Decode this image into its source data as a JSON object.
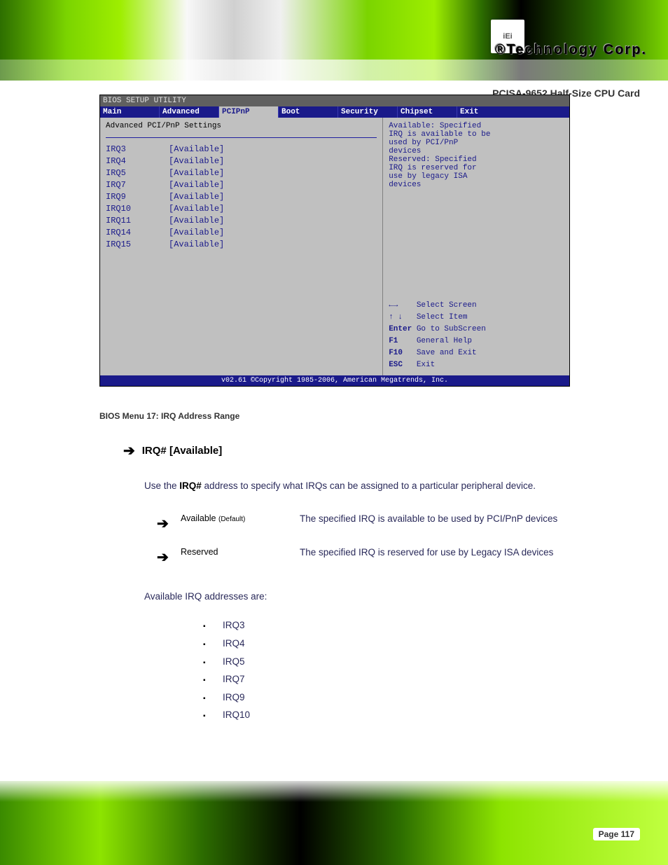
{
  "brand": {
    "logo_text": "iEi",
    "reg_text": "®Technology Corp.",
    "product_title": "PCISA-9652 Half-Size CPU Card"
  },
  "bios": {
    "title": "BIOS SETUP UTILITY",
    "tabs": [
      "Main",
      "Advanced",
      "PCIPnP",
      "Boot",
      "Security",
      "Chipset",
      "Exit"
    ],
    "active_tab_index": 2,
    "subtitle": "Advanced PCI/PnP Settings",
    "rows": [
      {
        "label": "IRQ3",
        "value": "Available"
      },
      {
        "label": "IRQ4",
        "value": "Available"
      },
      {
        "label": "IRQ5",
        "value": "Available"
      },
      {
        "label": "IRQ7",
        "value": "Available"
      },
      {
        "label": "IRQ9",
        "value": "Available"
      },
      {
        "label": "IRQ10",
        "value": "Available"
      },
      {
        "label": "IRQ11",
        "value": "Available"
      },
      {
        "label": "IRQ14",
        "value": "Available"
      },
      {
        "label": "IRQ15",
        "value": "Available"
      }
    ],
    "help": {
      "l1": "Available: Specified",
      "l2": "IRQ is available to be",
      "l3": "used by PCI/PnP",
      "l4": "devices",
      "l5": "Reserved: Specified",
      "l6": "IRQ is reserved for",
      "l7": "use by legacy ISA",
      "l8": "devices"
    },
    "keys": {
      "k1": "Select Screen",
      "k2": "Select Item",
      "k3_lbl": "Enter",
      "k3": "Go to SubScreen",
      "k4_lbl": "F1",
      "k4": "General Help",
      "k5_lbl": "F10",
      "k5": "Save and Exit",
      "k6_lbl": "ESC",
      "k6": "Exit"
    },
    "foot": "v02.61 ©Copyright 1985-2006, American Megatrends, Inc."
  },
  "caption": "BIOS Menu 17: IRQ Address Range",
  "doc": {
    "heading": "IRQ# [Available]",
    "para_a": "Use the ",
    "para_b": "IRQ#",
    "para_c": " address to specify what IRQs can be assigned to a particular peripheral device.",
    "opt1_label": "Available",
    "opt1_default": "(Default)",
    "opt1_desc": "The specified IRQ is available to be used by PCI/PnP devices",
    "opt2_label": "Reserved",
    "opt2_desc": "The specified IRQ is reserved for use by Legacy ISA devices",
    "avail_text": "Available IRQ addresses are:",
    "irq_list": [
      "IRQ3",
      "IRQ4",
      "IRQ5",
      "IRQ7",
      "IRQ9",
      "IRQ10"
    ]
  },
  "page_number": "Page 117"
}
